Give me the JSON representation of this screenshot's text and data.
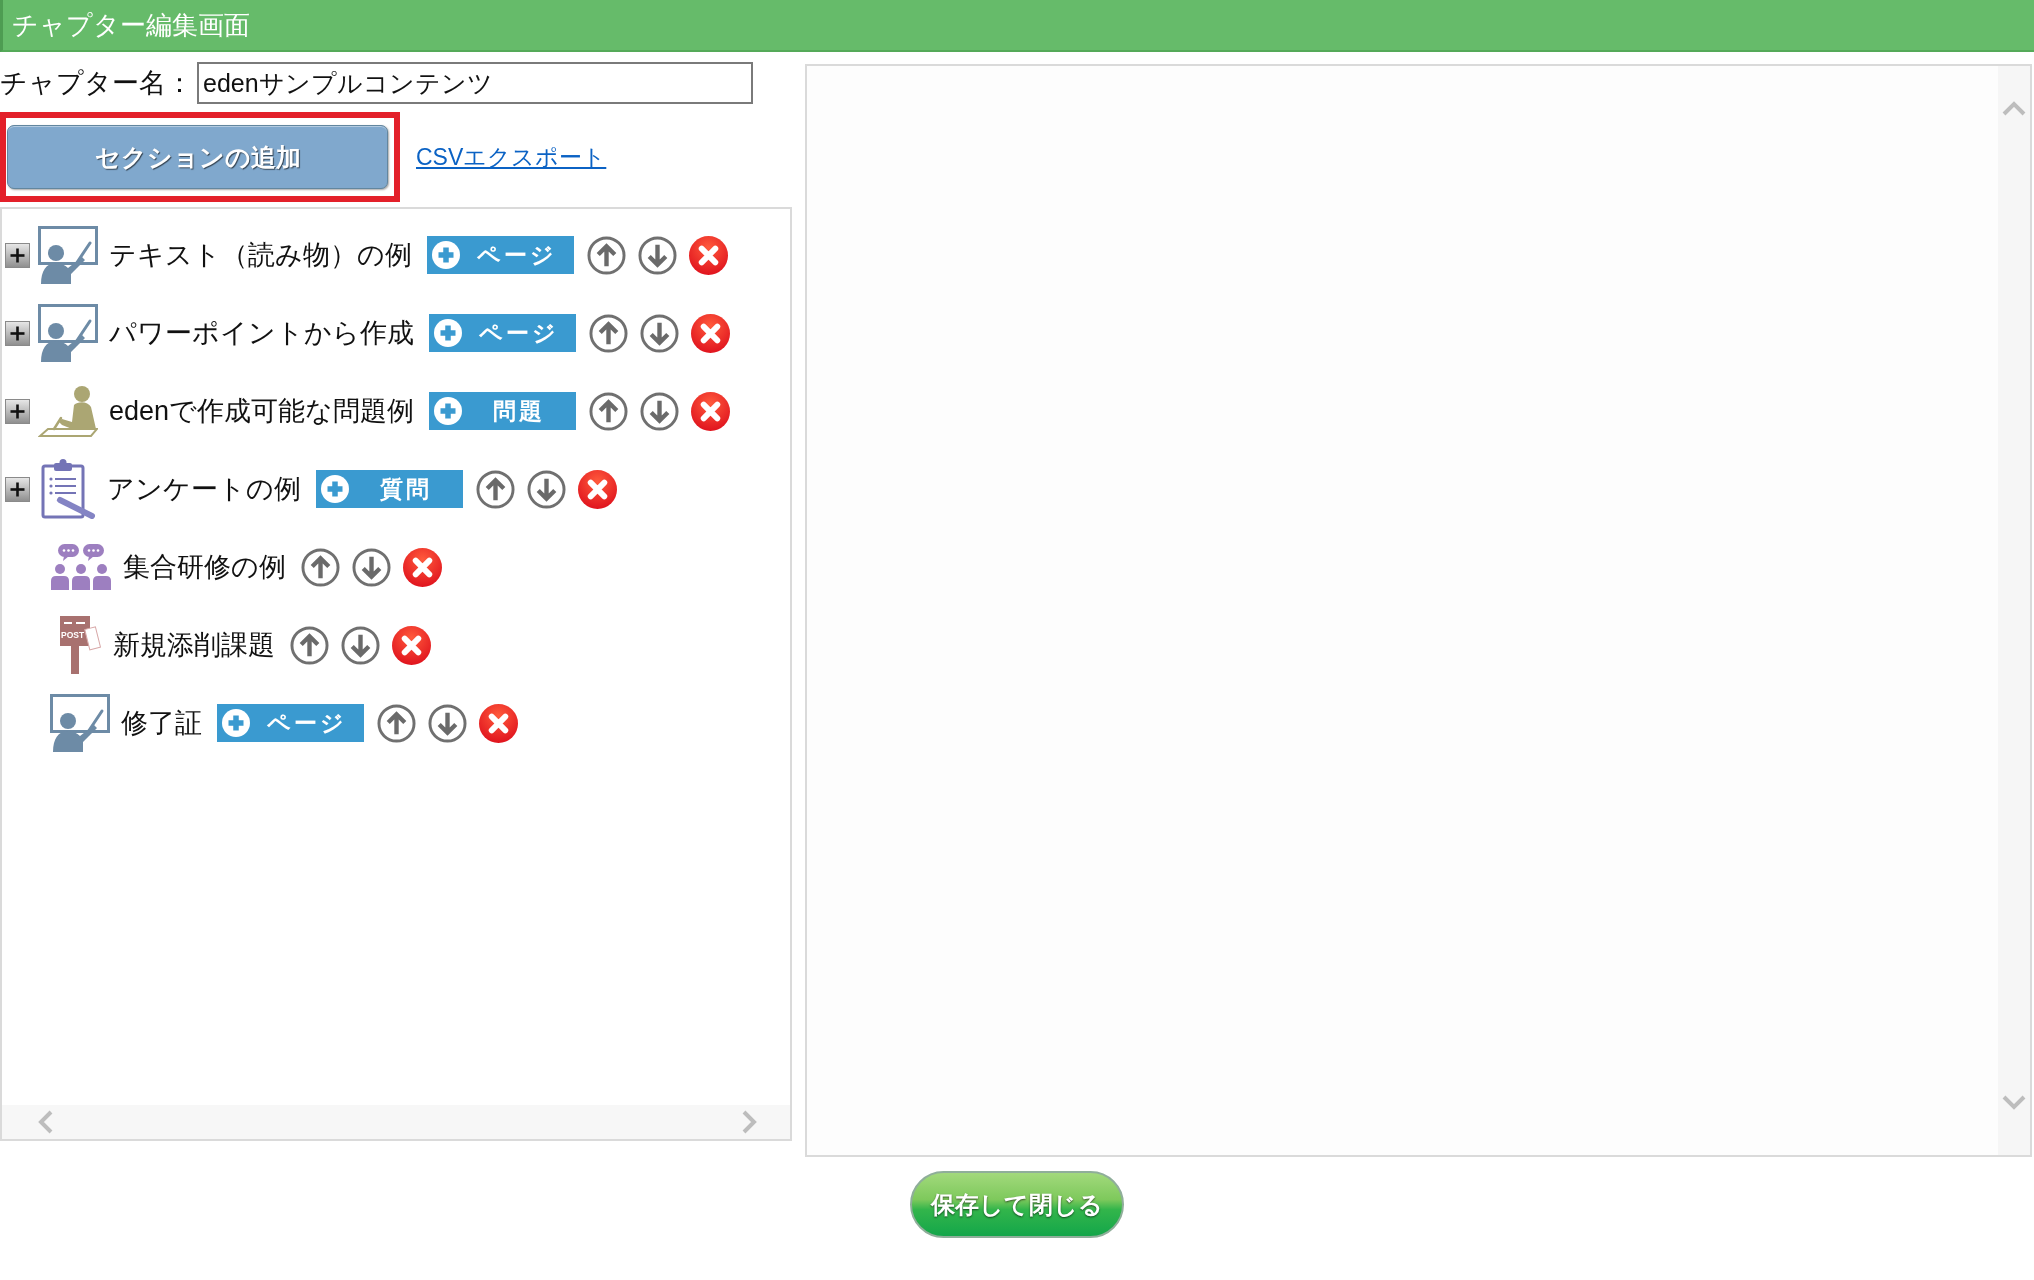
{
  "window": {
    "title": "チャプター編集画面"
  },
  "chapter_name": {
    "label": "チャプター名：",
    "value": "edenサンプルコンテンツ"
  },
  "toolbar": {
    "add_section_button": {
      "label": "セクションの追加",
      "highlighted": true
    },
    "csv_export_link": {
      "label": "CSVエクスポート"
    }
  },
  "sections": [
    {
      "kind": "lecture",
      "title": "テキスト（読み物）の例",
      "expanded": false,
      "add_button": {
        "label": "ページ"
      }
    },
    {
      "kind": "lecture",
      "title": "パワーポイントから作成",
      "expanded": false,
      "add_button": {
        "label": "ページ"
      }
    },
    {
      "kind": "exam",
      "title": "edenで作成可能な問題例",
      "expanded": false,
      "add_button": {
        "label": "問題"
      }
    },
    {
      "kind": "survey",
      "title": "アンケートの例",
      "expanded": false,
      "add_button": {
        "label": "質問"
      }
    },
    {
      "kind": "meeting",
      "title": "集合研修の例"
    },
    {
      "kind": "assignment",
      "title": "新規添削課題",
      "icon_text": "POST"
    },
    {
      "kind": "lecture",
      "title": "修了証",
      "add_button": {
        "label": "ページ"
      }
    }
  ],
  "save_button": {
    "label": "保存して閉じる"
  }
}
